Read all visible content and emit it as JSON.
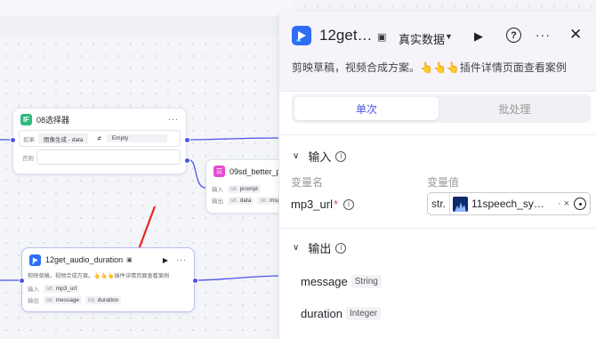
{
  "canvas": {
    "node_selector": {
      "icon_text": "IF",
      "title": "08选择器",
      "cond_label": "如果",
      "cond_left": "图像生成 - data",
      "cond_op": "≠",
      "cond_right": "Empty",
      "else_label": "否则"
    },
    "node_better": {
      "title": "09sd_better_p",
      "input_label": "输入",
      "input_type": "str.",
      "input_name": "prompt",
      "output_label": "输出",
      "out1_type": "str.",
      "out1_name": "data",
      "out2_type": "str.",
      "out2_name": "msg"
    },
    "node_audio": {
      "title": "12get_audio_duration",
      "desc": "剪映草稿，视频合成方案。👆👆👆插件详情页面查看案例",
      "input_label": "输入",
      "input_type": "str.",
      "input_name": "mp3_url",
      "output_label": "输出",
      "out1_type": "str.",
      "out1_name": "message",
      "out2_type": "int.",
      "out2_name": "duration"
    }
  },
  "panel": {
    "title": "12get…",
    "env_label": "真实数据",
    "description": "剪映草稿，视频合成方案。👆👆👆插件详情页面查看案例",
    "tabs": [
      {
        "label": "单次",
        "active": true
      },
      {
        "label": "批处理",
        "active": false
      }
    ],
    "input_section": "输入",
    "col_var_name": "变量名",
    "col_var_value": "变量值",
    "param": {
      "name": "mp3_url",
      "required": "*",
      "type": "str.",
      "value": "11speech_sy…"
    },
    "output_section": "输出",
    "outputs": [
      {
        "name": "message",
        "type": "String"
      },
      {
        "name": "duration",
        "type": "Integer"
      }
    ]
  },
  "colors": {
    "accent": "#4d53e8",
    "brand_blue": "#2f6df6",
    "selector_icon": "#2dbb7f",
    "better_icon": "#e44ccf",
    "arrow_red": "#e5281f"
  },
  "icons": {
    "panel_app": "play-logo-icon",
    "env": "data-env-icon",
    "run": "play-icon",
    "help": "help-circle-icon",
    "more": "more-icon",
    "close": "close-icon",
    "target": "target-icon"
  }
}
